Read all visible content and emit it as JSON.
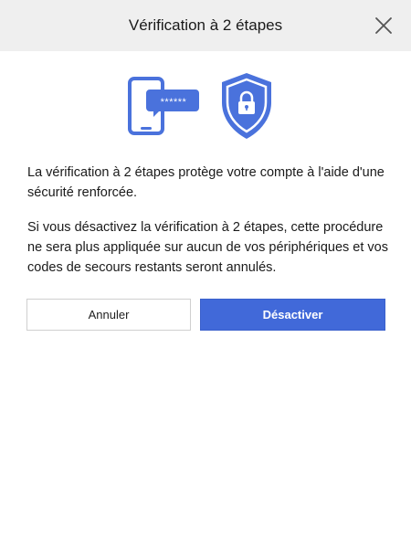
{
  "header": {
    "title": "Vérification à 2 étapes",
    "close_icon": "close-icon"
  },
  "illustration": {
    "phone_icon": "phone-password-icon",
    "password_mask": "******",
    "shield_icon": "shield-lock-icon",
    "accent_color": "#4a72dc"
  },
  "body": {
    "paragraph_1": "La vérification à 2 étapes protège votre compte à l'aide d'une sécurité renforcée.",
    "paragraph_2": "Si vous désactivez la vérification à 2 étapes, cette procédure ne sera plus appliquée sur aucun de vos périphériques et vos codes de secours restants seront annulés."
  },
  "actions": {
    "cancel_label": "Annuler",
    "disable_label": "Désactiver",
    "primary_color": "#4169d9"
  }
}
